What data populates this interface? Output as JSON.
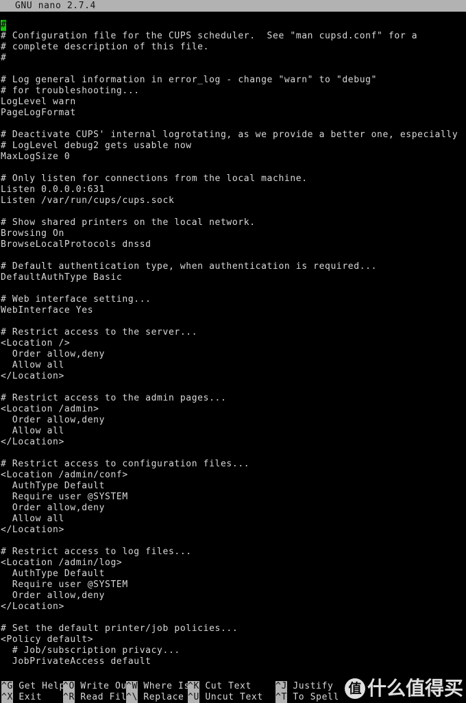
{
  "titlebar": {
    "app_title": "GNU nano 2.7.4"
  },
  "editor": {
    "cursor_char": "#",
    "cursor_color": "#16c60c",
    "lines": [
      "",
      "# Configuration file for the CUPS scheduler.  See \"man cupsd.conf\" for a",
      "# complete description of this file.",
      "#",
      "",
      "# Log general information in error_log - change \"warn\" to \"debug\"",
      "# for troubleshooting...",
      "LogLevel warn",
      "PageLogFormat",
      "",
      "# Deactivate CUPS' internal logrotating, as we provide a better one, especially",
      "# LogLevel debug2 gets usable now",
      "MaxLogSize 0",
      "",
      "# Only listen for connections from the local machine.",
      "Listen 0.0.0.0:631",
      "Listen /var/run/cups/cups.sock",
      "",
      "# Show shared printers on the local network.",
      "Browsing On",
      "BrowseLocalProtocols dnssd",
      "",
      "# Default authentication type, when authentication is required...",
      "DefaultAuthType Basic",
      "",
      "# Web interface setting...",
      "WebInterface Yes",
      "",
      "# Restrict access to the server...",
      "<Location />",
      "  Order allow,deny",
      "  Allow all",
      "</Location>",
      "",
      "# Restrict access to the admin pages...",
      "<Location /admin>",
      "  Order allow,deny",
      "  Allow all",
      "</Location>",
      "",
      "# Restrict access to configuration files...",
      "<Location /admin/conf>",
      "  AuthType Default",
      "  Require user @SYSTEM",
      "  Order allow,deny",
      "  Allow all",
      "</Location>",
      "",
      "# Restrict access to log files...",
      "<Location /admin/log>",
      "  AuthType Default",
      "  Require user @SYSTEM",
      "  Order allow,deny",
      "</Location>",
      "",
      "# Set the default printer/job policies...",
      "<Policy default>",
      "  # Job/subscription privacy...",
      "  JobPrivateAccess default"
    ]
  },
  "shortcuts": {
    "row1": [
      {
        "key": "^G",
        "label": " Get Help",
        "name": "get-help"
      },
      {
        "key": "^O",
        "label": " Write Out",
        "name": "write-out"
      },
      {
        "key": "^W",
        "label": " Where Is",
        "name": "where-is"
      },
      {
        "key": "^K",
        "label": " Cut Text",
        "name": "cut-text"
      },
      {
        "key": "^J",
        "label": " Justify",
        "name": "justify"
      }
    ],
    "row2": [
      {
        "key": "^X",
        "label": " Exit",
        "name": "exit"
      },
      {
        "key": "^R",
        "label": " Read File",
        "name": "read-file"
      },
      {
        "key": "^\\",
        "label": " Replace",
        "name": "replace"
      },
      {
        "key": "^U",
        "label": " Uncut Text",
        "name": "uncut-text"
      },
      {
        "key": "^T",
        "label": " To Spell",
        "name": "to-spell"
      }
    ]
  },
  "watermark": {
    "badge": "值",
    "text": "什么值得买"
  }
}
